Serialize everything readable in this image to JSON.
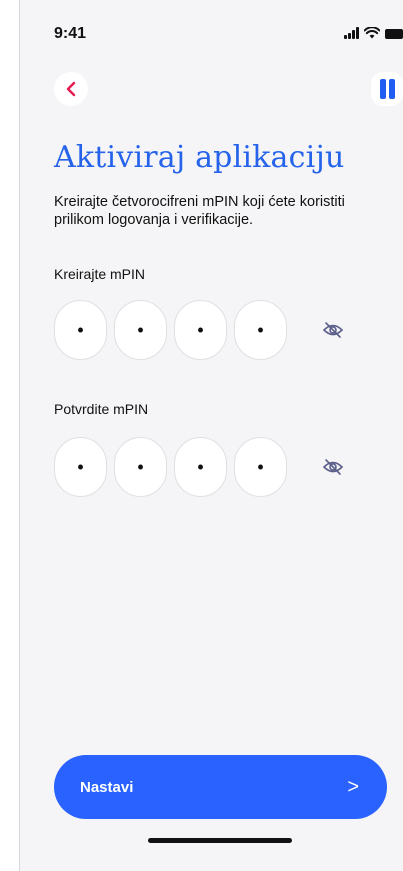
{
  "status_bar": {
    "time": "9:41",
    "icons": [
      "signal-icon",
      "wifi-icon",
      "battery-icon"
    ]
  },
  "header": {
    "back_icon": "chevron-left-icon",
    "menu_icon": "pause-menu-icon"
  },
  "title": "Aktiviraj aplikaciju",
  "subtitle": "Kreirajte četvorocifreni mPIN koji ćete koristiti prilikom logovanja i verifikacije.",
  "create_pin": {
    "label": "Kreirajte mPIN",
    "digits": [
      "•",
      "•",
      "•",
      "•"
    ],
    "toggle_icon": "eye-off-icon"
  },
  "confirm_pin": {
    "label": "Potvrdite mPIN",
    "digits": [
      "•",
      "•",
      "•",
      "•"
    ],
    "toggle_icon": "eye-off-icon"
  },
  "next_button": {
    "label": "Nastavi",
    "icon": "chevron-right-icon",
    "chevron": ">"
  },
  "colors": {
    "accent": "#2962ff",
    "title": "#2563eb",
    "back": "#e5194f",
    "background": "#f5f5f7"
  }
}
